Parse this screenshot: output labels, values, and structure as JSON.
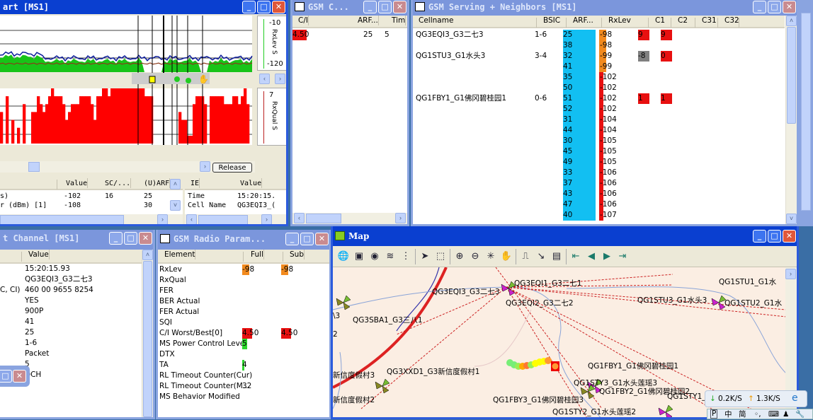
{
  "chart_window": {
    "title": "art [MS1]",
    "axis_top": {
      "label": "RxLev S",
      "max": "-10",
      "min": "-120"
    },
    "axis_bottom": {
      "label": "RxQual S",
      "max": "7",
      "min": "0"
    },
    "release_button": "Release",
    "rxqual_samples": [
      4,
      0,
      6,
      0,
      3,
      0,
      2,
      0,
      5,
      0,
      0,
      4,
      4,
      6,
      5,
      4,
      5,
      6,
      7,
      6,
      6,
      6,
      5,
      3,
      4,
      5,
      5,
      5,
      6,
      6,
      6,
      6,
      5,
      3,
      6,
      6,
      7,
      7,
      6,
      7,
      7,
      7,
      7,
      7,
      7,
      7,
      7,
      7,
      7,
      7,
      7,
      6,
      6,
      6,
      0,
      0,
      0,
      0,
      0,
      0,
      0,
      0,
      0,
      4,
      3,
      3,
      1,
      1,
      5,
      6,
      6,
      6,
      5,
      0,
      6,
      6,
      6,
      6,
      6,
      5,
      5,
      5,
      6,
      6,
      5,
      6,
      7,
      5,
      0
    ]
  },
  "measure_table": {
    "headers": [
      "Value",
      "SC/...",
      "(U)ARF"
    ],
    "rows": [
      {
        "label": "s)",
        "value": "-102",
        "sc": "16",
        "arfcn": "25"
      },
      {
        "label": "r (dBm) [1]",
        "value": "-108",
        "sc": "",
        "arfcn": "30"
      }
    ]
  },
  "ie_table": {
    "headers": [
      "IE",
      "Value"
    ],
    "rows": [
      {
        "ie": "Time",
        "value": "15:20:15."
      },
      {
        "ie": "Cell Name",
        "value": "QG3EQI3_("
      }
    ]
  },
  "ci_window": {
    "title": "GSM C...",
    "headers": [
      "C/I",
      "ARF...",
      "Tim"
    ],
    "rows": [
      {
        "ci": "4.50",
        "arfcn": "25",
        "ts": "5"
      }
    ]
  },
  "serving_window": {
    "title": "GSM Serving + Neighbors [MS1]",
    "headers": [
      "Cellname",
      "BSIC",
      "ARF...",
      "RxLev",
      "C1",
      "C2",
      "C31",
      "C32"
    ],
    "rows": [
      {
        "cell": "QG3EQI3_G3二七3",
        "bsic": "1-6",
        "arfcn": "25",
        "rxlev": "-98",
        "c1": "9",
        "c2": "9"
      },
      {
        "cell": "",
        "bsic": "",
        "arfcn": "38",
        "rxlev": "-98",
        "c1": "",
        "c2": ""
      },
      {
        "cell": "QG1STU3_G1水头3",
        "bsic": "3-4",
        "arfcn": "32",
        "rxlev": "-99",
        "c1": "-8",
        "c2": "0"
      },
      {
        "cell": "",
        "bsic": "",
        "arfcn": "41",
        "rxlev": "-99",
        "c1": "",
        "c2": ""
      },
      {
        "cell": "",
        "bsic": "",
        "arfcn": "35",
        "rxlev": "-102",
        "c1": "",
        "c2": ""
      },
      {
        "cell": "",
        "bsic": "",
        "arfcn": "50",
        "rxlev": "-102",
        "c1": "",
        "c2": ""
      },
      {
        "cell": "QG1FBY1_G1佛冈碧桂园1",
        "bsic": "0-6",
        "arfcn": "51",
        "rxlev": "-102",
        "c1": "1",
        "c2": "1"
      },
      {
        "cell": "",
        "bsic": "",
        "arfcn": "52",
        "rxlev": "-102",
        "c1": "",
        "c2": ""
      },
      {
        "cell": "",
        "bsic": "",
        "arfcn": "31",
        "rxlev": "-104",
        "c1": "",
        "c2": ""
      },
      {
        "cell": "",
        "bsic": "",
        "arfcn": "44",
        "rxlev": "-104",
        "c1": "",
        "c2": ""
      },
      {
        "cell": "",
        "bsic": "",
        "arfcn": "30",
        "rxlev": "-105",
        "c1": "",
        "c2": ""
      },
      {
        "cell": "",
        "bsic": "",
        "arfcn": "45",
        "rxlev": "-105",
        "c1": "",
        "c2": ""
      },
      {
        "cell": "",
        "bsic": "",
        "arfcn": "49",
        "rxlev": "-105",
        "c1": "",
        "c2": ""
      },
      {
        "cell": "",
        "bsic": "",
        "arfcn": "33",
        "rxlev": "-106",
        "c1": "",
        "c2": ""
      },
      {
        "cell": "",
        "bsic": "",
        "arfcn": "37",
        "rxlev": "-106",
        "c1": "",
        "c2": ""
      },
      {
        "cell": "",
        "bsic": "",
        "arfcn": "43",
        "rxlev": "-106",
        "c1": "",
        "c2": ""
      },
      {
        "cell": "",
        "bsic": "",
        "arfcn": "47",
        "rxlev": "-106",
        "c1": "",
        "c2": ""
      },
      {
        "cell": "",
        "bsic": "",
        "arfcn": "40",
        "rxlev": "-107",
        "c1": "",
        "c2": ""
      }
    ]
  },
  "channel_window": {
    "title": "t Channel [MS1]",
    "header": "Value",
    "rows": [
      {
        "label": "",
        "value": "15:20:15.93"
      },
      {
        "label": "",
        "value": "QG3EQI3_G3二七3"
      },
      {
        "label": "C, CI)",
        "value": "460 00 9655 8254"
      },
      {
        "label": "",
        "value": "YES"
      },
      {
        "label": "",
        "value": "900P"
      },
      {
        "label": "",
        "value": "41"
      },
      {
        "label": "",
        "value": "25"
      },
      {
        "label": "",
        "value": "1-6"
      },
      {
        "label": "",
        "value": "Packet"
      },
      {
        "label": "",
        "value": "5"
      },
      {
        "label": "",
        "value": "DCH"
      }
    ]
  },
  "radio_window": {
    "title": "GSM Radio Param...",
    "headers": [
      "Element",
      "Full",
      "Sub"
    ],
    "rows": [
      {
        "el": "RxLev",
        "full": "-98",
        "sub": "-98"
      },
      {
        "el": "RxQual",
        "full": "",
        "sub": ""
      },
      {
        "el": "FER",
        "full": "",
        "sub": ""
      },
      {
        "el": "BER Actual",
        "full": "",
        "sub": ""
      },
      {
        "el": "FER Actual",
        "full": "",
        "sub": ""
      },
      {
        "el": "SQI",
        "full": "",
        "sub": ""
      },
      {
        "el": "C/I Worst/Best[0]",
        "full": "4.50",
        "sub": "4.50"
      },
      {
        "el": "MS Power Control Level",
        "full": "5",
        "sub": ""
      },
      {
        "el": "DTX",
        "full": "",
        "sub": ""
      },
      {
        "el": "TA",
        "full": "4",
        "sub": ""
      },
      {
        "el": "RL Timeout Counter(Cur)",
        "full": "",
        "sub": ""
      },
      {
        "el": "RL Timeout Counter(M...",
        "full": "32",
        "sub": ""
      },
      {
        "el": "MS Behavior Modified",
        "full": "",
        "sub": ""
      }
    ]
  },
  "map_window": {
    "title": "Map",
    "labels": [
      "QG3EQI1_G3二七1",
      "QG3EQI3_G3二七3",
      "QG3EQI2_G3二七2",
      "QG3SBA1_G3三八1",
      "\\3",
      "QG1STU1_G1水",
      "QG1STU3_G1水头3",
      "QG1STU2_G1水",
      "QG1FBY1_G1佛冈碧桂园1",
      "QG1STY3_G1水头莲瑶3",
      "QG1FBY2_G1佛冈碧桂园2",
      "QG1STY1_G1水头莲瑶1",
      "QG1FBY3_G1佛冈碧桂园3",
      "QG1STY2_G1水头莲瑶2",
      "QG3XXD1_G3新信度假村1",
      "新信度假村3",
      "新信度假村2",
      "2"
    ],
    "toolbar": [
      "globe-layer",
      "image",
      "world",
      "layers",
      "legend",
      "select",
      "rect-select",
      "zoom-in",
      "zoom-out",
      "full-extent",
      "pan",
      "measure",
      "arrow",
      "report",
      "first",
      "prev",
      "next",
      "last"
    ]
  },
  "tray": {
    "down": "0.2K/S",
    "up": "1.3K/S",
    "ime": [
      "中",
      "简"
    ]
  },
  "colors": {
    "orange": "#f28a1e",
    "red": "#e81010",
    "cyan": "#12bff2",
    "green": "#2dd62d",
    "gray": "#808080"
  }
}
